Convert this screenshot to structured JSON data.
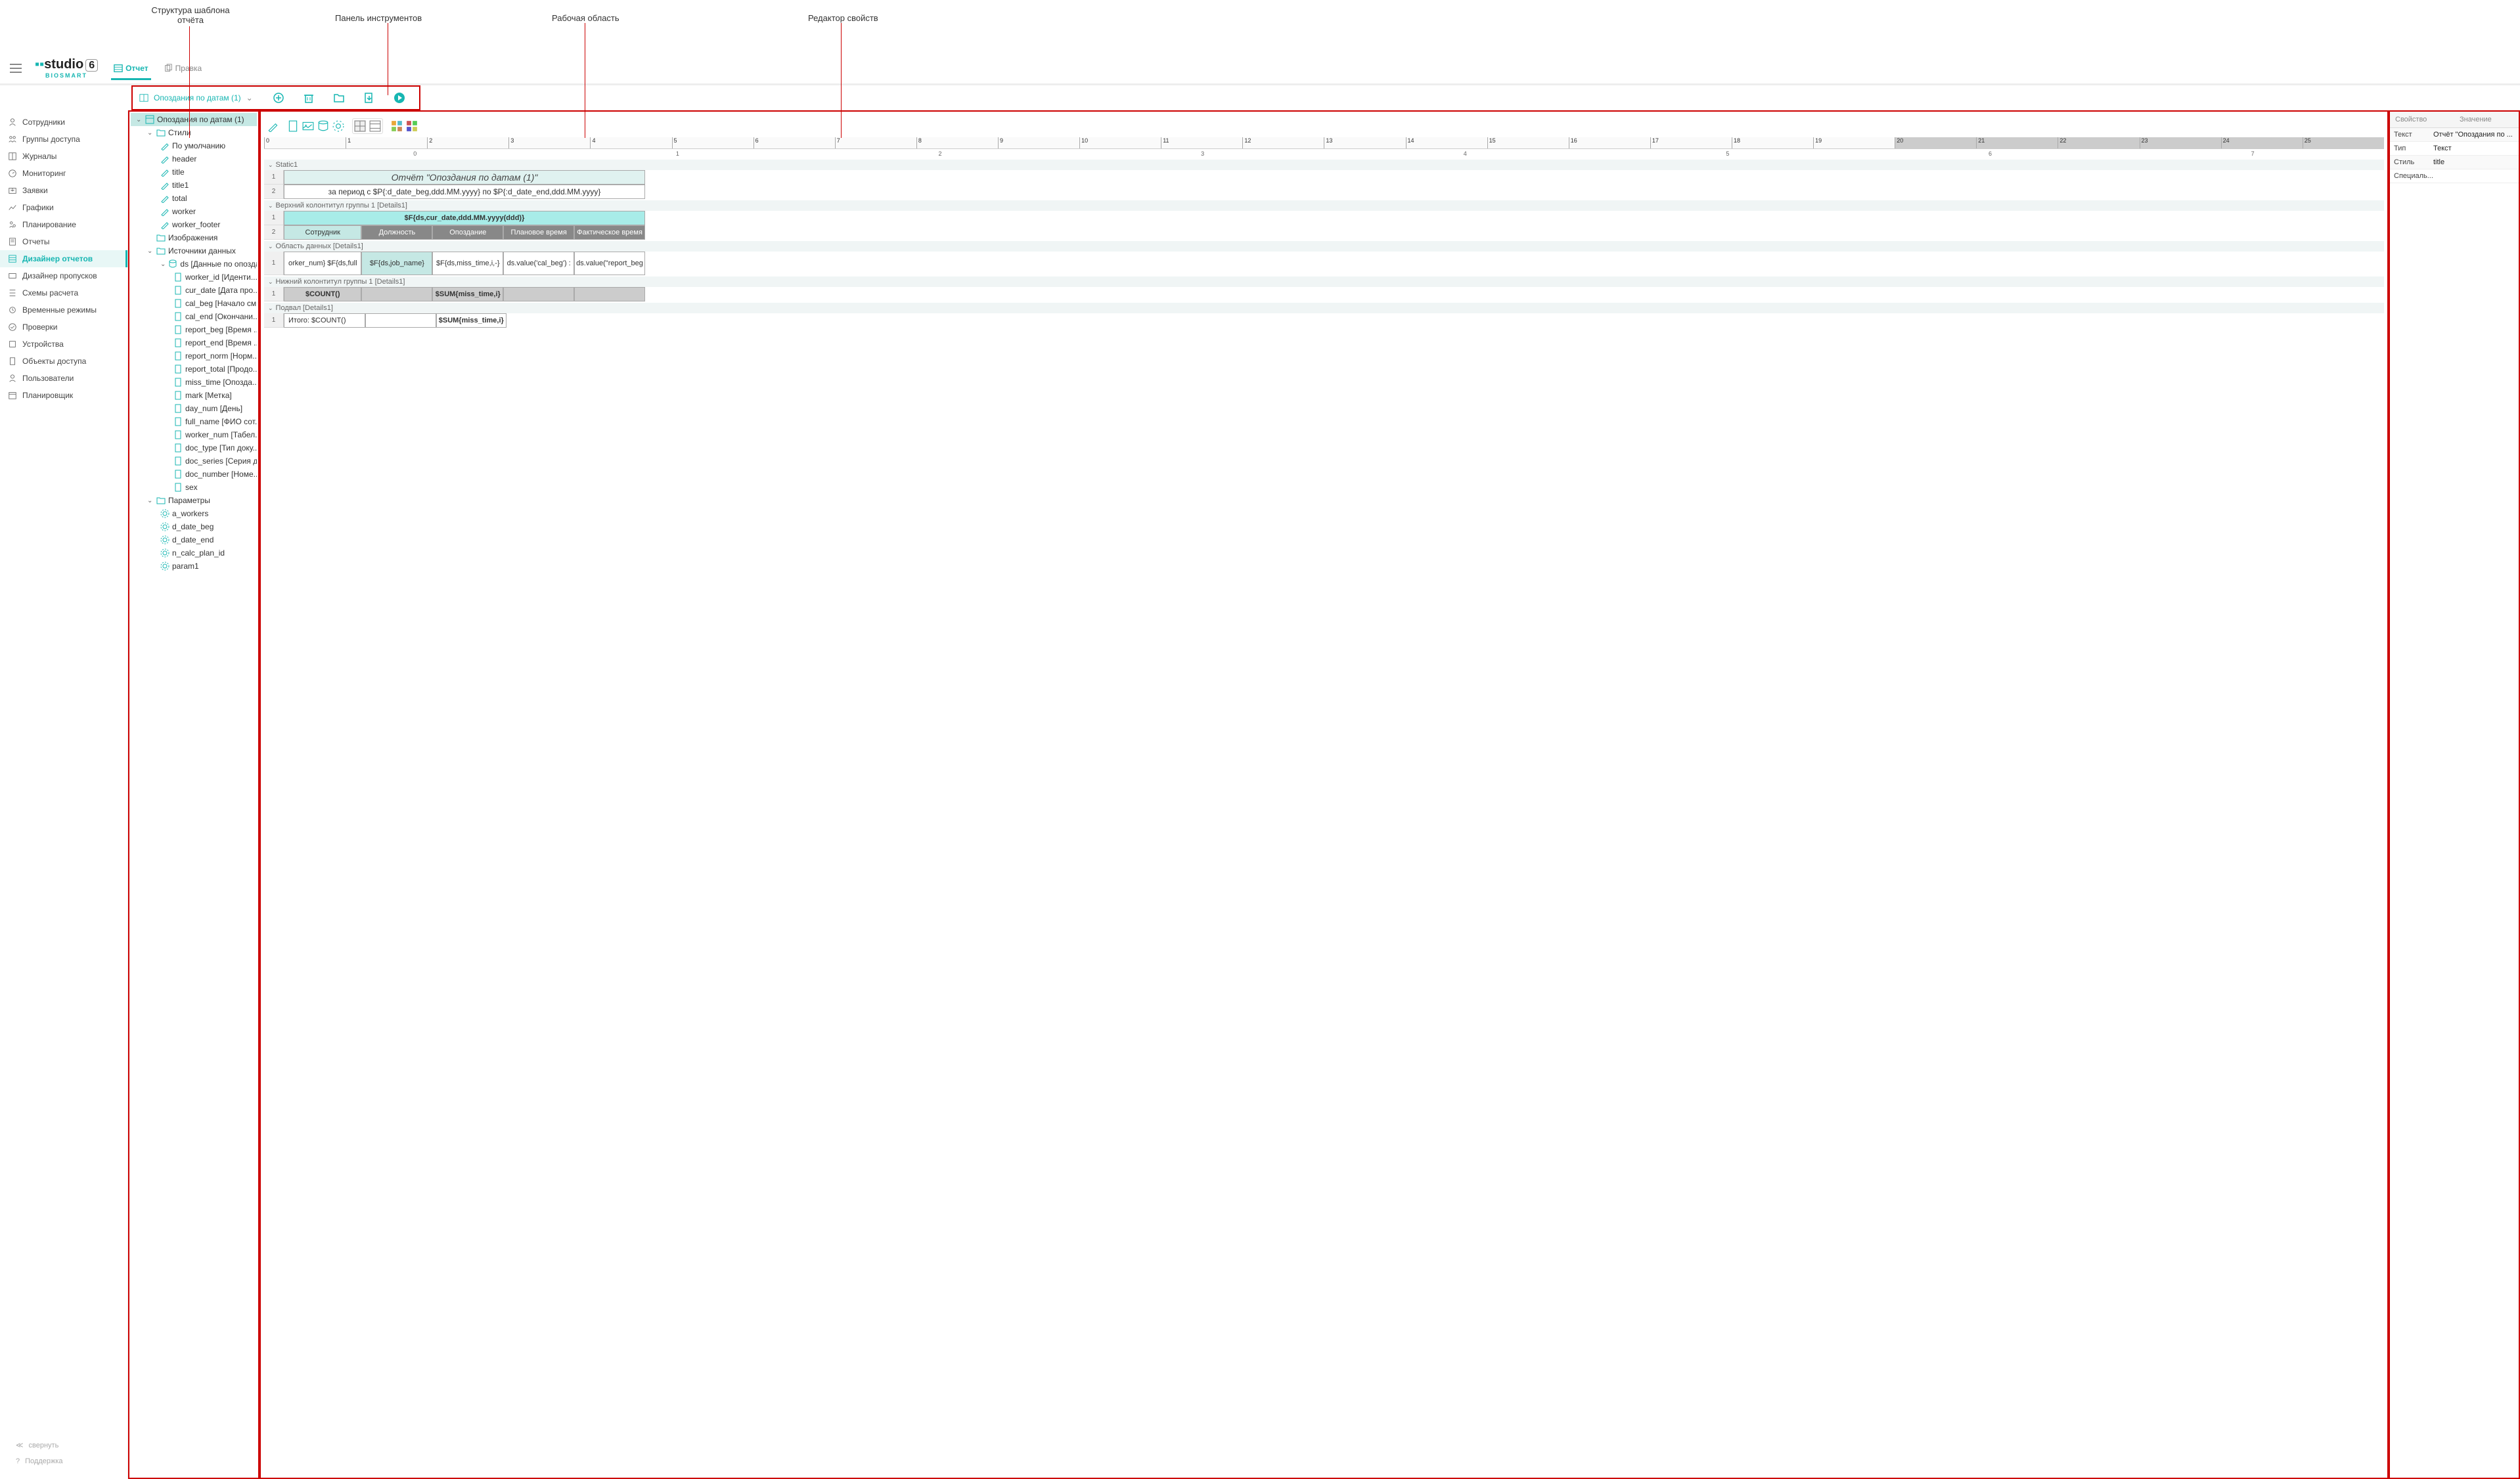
{
  "annotations": {
    "structure": "Структура шаблона\nотчёта",
    "toolbar": "Панель инструментов",
    "workspace": "Рабочая область",
    "props": "Редактор свойств"
  },
  "logo": {
    "text": "studio",
    "suffix": "6",
    "sub": "BIOSMART"
  },
  "tabs": {
    "report": "Отчет",
    "edit": "Правка"
  },
  "toolbar": {
    "dropdown": "Опоздания по датам (1)"
  },
  "sidebar": {
    "items": [
      "Сотрудники",
      "Группы доступа",
      "Журналы",
      "Мониторинг",
      "Заявки",
      "Графики",
      "Планирование",
      "Отчеты",
      "Дизайнер отчетов",
      "Дизайнер пропусков",
      "Схемы расчета",
      "Временные режимы",
      "Проверки",
      "Устройства",
      "Объекты доступа",
      "Пользователи",
      "Планировщик"
    ],
    "active": 8,
    "collapse": "свернуть",
    "support": "Поддержка"
  },
  "tree": {
    "root": "Опоздания по датам (1)",
    "styles": {
      "label": "Стили",
      "items": [
        "По умолчанию",
        "header",
        "title",
        "title1",
        "total",
        "worker",
        "worker_footer"
      ]
    },
    "images": "Изображения",
    "sources": {
      "label": "Источники данных",
      "ds": {
        "label": "ds [Данные по опозда...",
        "fields": [
          "worker_id [Иденти...",
          "cur_date [Дата про...",
          "cal_beg [Начало см...",
          "cal_end [Окончани...",
          "report_beg [Время ...",
          "report_end [Время ...",
          "report_norm [Норм...",
          "report_total [Продо...",
          "miss_time [Опозда...",
          "mark [Метка]",
          "day_num [День]",
          "full_name [ФИО сот...",
          "worker_num [Табел...",
          "doc_type [Тип доку...",
          "doc_series [Серия д...",
          "doc_number [Номе...",
          "sex"
        ]
      }
    },
    "params": {
      "label": "Параметры",
      "items": [
        "a_workers",
        "d_date_beg",
        "d_date_end",
        "n_calc_plan_id",
        "param1"
      ]
    }
  },
  "report": {
    "bands": {
      "static": {
        "label": "Static1",
        "title": "Отчёт \"Опоздания по датам (1)\"",
        "subtitle": "за период с $P{:d_date_beg,ddd.MM.yyyy} по $P{:d_date_end,ddd.MM.yyyy}"
      },
      "group_header": {
        "label": "Верхний колонтитул группы 1 [Details1]",
        "date": "$F{ds,cur_date,ddd.MM.yyyy(ddd)}",
        "cols": [
          "Сотрудник",
          "Должность",
          "Опоздание",
          "Плановое время",
          "Фактическое время"
        ]
      },
      "detail": {
        "label": "Область данных [Details1]",
        "cells": [
          "orker_num} $F{ds,full",
          "$F{ds,job_name}",
          "$F{ds,miss_time,i,-}",
          "ds.value('cal_beg') :",
          "ds.value(\"report_beg"
        ]
      },
      "group_footer": {
        "label": "Нижний колонтитул группы 1 [Details1]",
        "count": "$COUNT()",
        "sum": "$SUM{miss_time,i}"
      },
      "footer": {
        "label": "Подвал [Details1]",
        "total": "Итого: $COUNT()",
        "sum": "$SUM{miss_time,i}"
      }
    }
  },
  "props": {
    "header": {
      "name": "Свойство",
      "value": "Значение"
    },
    "rows": [
      {
        "k": "Текст",
        "v": "Отчёт \"Опоздания по ..."
      },
      {
        "k": "Тип",
        "v": "Текст"
      },
      {
        "k": "Стиль",
        "v": "title"
      },
      {
        "k": "Специаль...",
        "v": ""
      }
    ]
  }
}
